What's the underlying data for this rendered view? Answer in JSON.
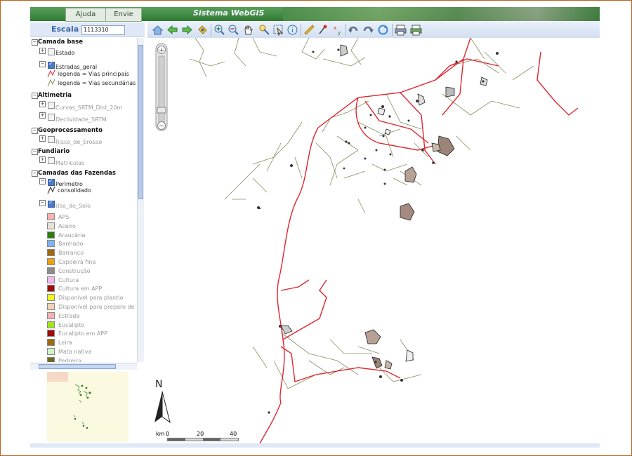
{
  "header": {
    "tabs": [
      "Ajuda",
      "Envie Dicas"
    ],
    "title": "Sistema WebGIS"
  },
  "scale": {
    "label": "Escala 1:",
    "value": "1113310"
  },
  "layers": {
    "groups": [
      {
        "name": "Camada base"
      },
      {
        "name": "Altimetria"
      },
      {
        "name": "Geoprocessamento"
      },
      {
        "name": "Fundiario"
      },
      {
        "name": "Camadas das Fazendas"
      }
    ],
    "items": {
      "estado": "Estado",
      "estradas_geral": "Estradas_geral",
      "legenda_principais": "legenda = Vias principais",
      "legenda_secundarias": "legenda = Vias secundárias",
      "curvas": "Curvas_SRTM_Dist_20m",
      "declividade": "Declividade_SRTM",
      "risco": "Risco_de_Erosao",
      "matriculas": "Matriculas",
      "perimetro": "Perimetro",
      "consolidado": "consolidado",
      "uso_do_solo": "Uso_do_Solo"
    },
    "uso_do_solo_legend": [
      {
        "label": "APS",
        "color": "#f6b2b2"
      },
      {
        "label": "Aceiro",
        "color": "#e3e0d7"
      },
      {
        "label": "Araucária",
        "color": "#2e7d10"
      },
      {
        "label": "Banhado",
        "color": "#7fb2f0"
      },
      {
        "label": "Barranco",
        "color": "#a2690d"
      },
      {
        "label": "Capoeira fina",
        "color": "#f2a20a"
      },
      {
        "label": "Construção",
        "color": "#8c8c8c"
      },
      {
        "label": "Cultura",
        "color": "#f3b7ef"
      },
      {
        "label": "Cultura em APP",
        "color": "#a10a0a"
      },
      {
        "label": "Disponível para plantio",
        "color": "#f6f61a"
      },
      {
        "label": "Disponível para preparo de",
        "color": "#eed4b4"
      },
      {
        "label": "Estrada",
        "color": "#f6b2b2"
      },
      {
        "label": "Eucalipto",
        "color": "#a2e61a"
      },
      {
        "label": "Eucalipto em APP",
        "color": "#a10a0a"
      },
      {
        "label": "Leira",
        "color": "#a2690d"
      },
      {
        "label": "Mata nativa",
        "color": "#cdf3c2"
      },
      {
        "label": "Pedreira",
        "color": "#6b6b1e"
      }
    ],
    "legend_colors": {
      "principais": "#e0262e",
      "secundarias": "#8a8a60"
    }
  },
  "map": {
    "north_label": "N",
    "scale_unit": "km",
    "scale_ticks": [
      "0",
      "20",
      "40"
    ],
    "colors": {
      "main_roads": "#e0262e",
      "secondary_roads": "#8a8a60",
      "farms": "#222222"
    }
  },
  "toolbar": {
    "tools": [
      "home-icon",
      "back-arrow-icon",
      "forward-arrow-icon",
      "pan-to-icon",
      "zoom-in-icon",
      "zoom-out-icon",
      "hand-icon",
      "identify-icon",
      "select-icon",
      "info-icon",
      "measure-distance-icon",
      "measure-point-icon",
      "coordinates-icon",
      "undo-icon",
      "redo-icon",
      "refresh-icon",
      "print-icon",
      "printer-setup-icon"
    ]
  }
}
